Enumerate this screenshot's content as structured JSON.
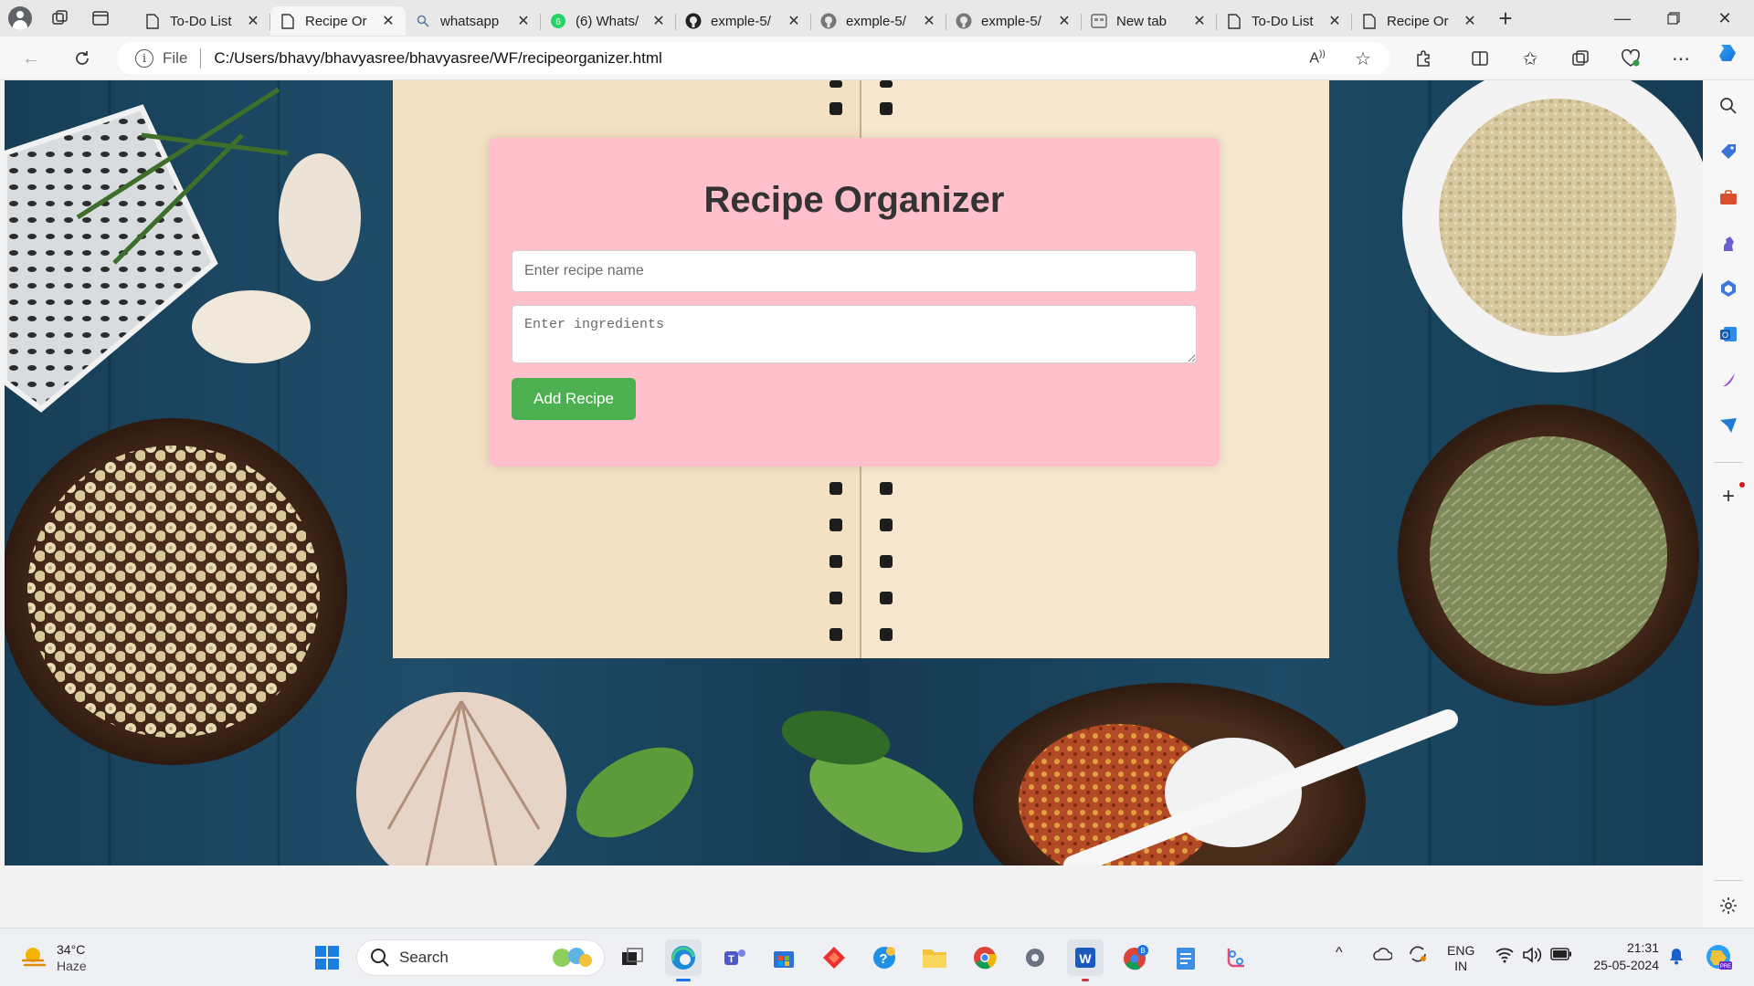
{
  "browser": {
    "tabs": [
      {
        "title": "To-Do List",
        "icon": "page-icon",
        "active": false
      },
      {
        "title": "Recipe Or",
        "icon": "page-icon",
        "active": true
      },
      {
        "title": "whatsapp",
        "icon": "search-icon",
        "active": false
      },
      {
        "title": "(6) Whats/",
        "icon": "whatsapp-icon",
        "active": false
      },
      {
        "title": "exmple-5/",
        "icon": "github-icon",
        "active": false
      },
      {
        "title": "exmple-5/",
        "icon": "github-icon",
        "active": false
      },
      {
        "title": "exmple-5/",
        "icon": "github-icon",
        "active": false
      },
      {
        "title": "New tab",
        "icon": "new-tab-icon",
        "active": false
      },
      {
        "title": "To-Do List",
        "icon": "page-icon",
        "active": false
      },
      {
        "title": "Recipe Or",
        "icon": "page-icon",
        "active": false
      }
    ],
    "address": {
      "scheme_label": "File",
      "url": "C:/Users/bhavy/bhavyasree/bhavyasree/WF/recipeorganizer.html"
    }
  },
  "page": {
    "title": "Recipe Organizer",
    "recipe_name_placeholder": "Enter recipe name",
    "ingredients_placeholder": "Enter ingredients",
    "add_button_label": "Add Recipe",
    "colors": {
      "card": "#ffc0cb",
      "button": "#4caf50",
      "title": "#333333"
    }
  },
  "taskbar": {
    "weather": {
      "temp": "34°C",
      "condition": "Haze"
    },
    "search_label": "Search",
    "language": {
      "line1": "ENG",
      "line2": "IN"
    },
    "clock": {
      "time": "21:31",
      "date": "25-05-2024"
    }
  }
}
